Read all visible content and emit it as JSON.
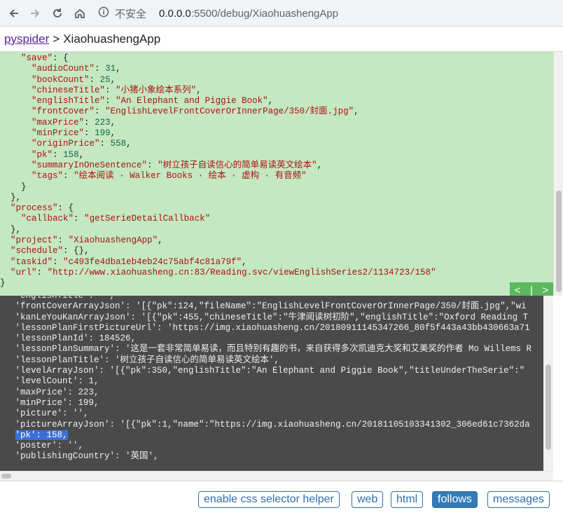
{
  "browser": {
    "security_label": "不安全",
    "url_host": "0.0.0.0",
    "url_rest": ":5500/debug/XiaohuashengApp"
  },
  "header": {
    "root_link": "pyspider",
    "separator": ">",
    "project_name": "XiaohuashengApp"
  },
  "task_json_lines": [
    "    \"save\": {",
    "      \"audioCount\": 31,",
    "      \"bookCount\": 25,",
    "      \"chineseTitle\": \"小猪小象绘本系列\",",
    "      \"englishTitle\": \"An Elephant and Piggie Book\",",
    "      \"frontCover\": \"EnglishLevelFrontCoverOrInnerPage/350/封面.jpg\",",
    "      \"maxPrice\": 223,",
    "      \"minPrice\": 199,",
    "      \"originPrice\": 558,",
    "      \"pk\": 158,",
    "      \"summaryInOneSentence\": \"树立孩子自读信心的简单易读英文绘本\",",
    "      \"tags\": \"绘本阅读 · Walker Books · 绘本 · 虚构 · 有音频\"",
    "    }",
    "  },",
    "  \"process\": {",
    "    \"callback\": \"getSerieDetailCallback\"",
    "  },",
    "  \"project\": \"XiaohuashengApp\",",
    "  \"schedule\": {},",
    "  \"taskid\": \"c493fe4dba1eb4eb24c75abf4c81a79f\",",
    "  \"url\": \"http://www.xiaohuasheng.cn:83/Reading.svc/viewEnglishSeries2/1134723/158\"",
    "}"
  ],
  "pager": {
    "prev": "<",
    "divider": "|",
    "next": ">"
  },
  "output_lines": [
    " 'englishTitle': '',",
    " 'frontCoverArrayJson': '[{\"pk\":124,\"fileName\":\"EnglishLevelFrontCoverOrInnerPage/350/封面.jpg\",\"wi",
    " 'kanLeYouKanArrayJson': '[{\"pk\":455,\"chineseTitle\":\"牛津阅读树初阶\",\"englishTitle\":\"Oxford Reading T",
    " 'lessonPlanFirstPictureUrl': 'https://img.xiaohuasheng.cn/20180911145347266_80f5f443a43bb430663a71",
    " 'lessonPlanId': 184526,",
    " 'lessonPlanSummary': '这是一套非常简单易读，而且特别有趣的书，来自获得多次凯迪克大奖和艾美奖的作者 Mo Willems R",
    " 'lessonPlanTitle': '树立孩子自读信心的简单易读英文绘本',",
    " 'levelArrayJson': '[{\"pk\":350,\"englishTitle\":\"An Elephant and Piggie Book\",\"titleUnderTheSerie\":\"",
    " 'levelCount': 1,",
    " 'maxPrice': 223,",
    " 'minPrice': 199,",
    " 'picture': '',",
    " 'pictureArrayJson': '[{\"pk\":1,\"name\":\"https://img.xiaohuasheng.cn/20181105103341302_306ed61c7362da",
    " 'pk': 158,",
    " 'poster': '',",
    " 'publishingCountry': '英国',"
  ],
  "highlighted_output_line": 13,
  "toolbar": {
    "css_helper": "enable css selector helper",
    "web": "web",
    "html": "html",
    "follows": "follows",
    "messages": "messages"
  },
  "colors": {
    "task_bg": "#c4e8c1",
    "output_bg": "#4a4a4a",
    "accent": "#337ab7",
    "pager_bg": "#5cb85c",
    "highlight": "#3b6fd8"
  }
}
